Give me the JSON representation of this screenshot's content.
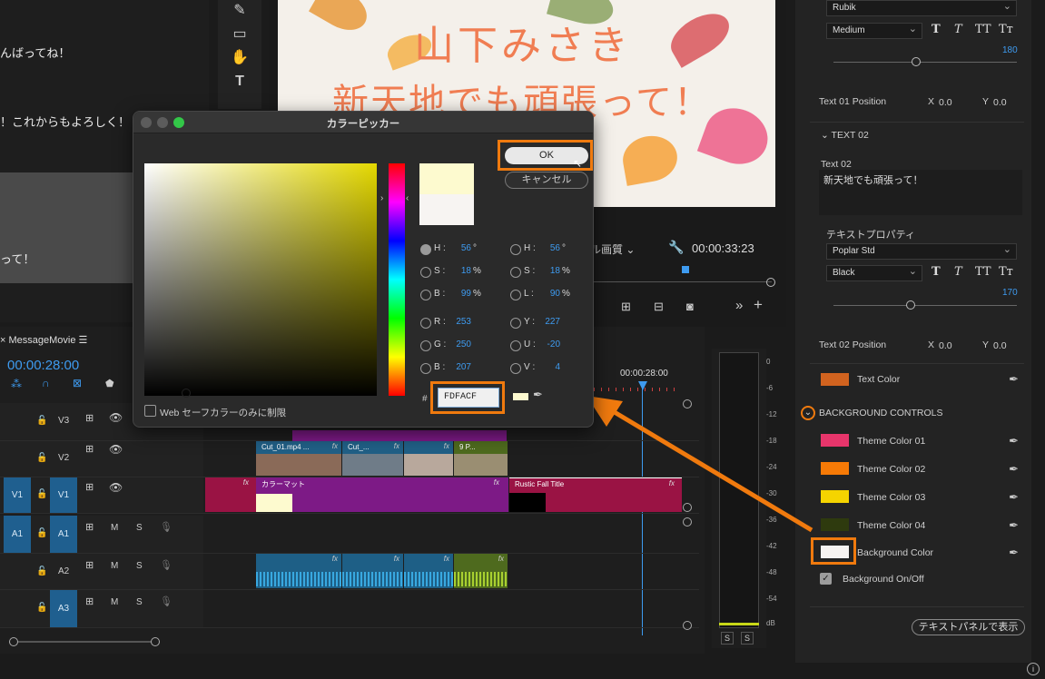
{
  "left_preview": {
    "line1": "んばってね！",
    "line2": "！これからもよろしく！",
    "line3": "って！"
  },
  "program": {
    "title_line1": "山下みさき",
    "title_line2": "新天地でも頑張って！",
    "quality": "ル画質",
    "timecode": "00:00:33:23"
  },
  "timeline": {
    "sequence_name": "MessageMovie",
    "timecode": "00:00:28:00",
    "ruler_time": "00:00:28:00",
    "tracks": [
      {
        "target": "",
        "label": "V3"
      },
      {
        "target": "",
        "label": "V2"
      },
      {
        "target": "V1",
        "label": "V1"
      },
      {
        "target": "A1",
        "label": "A1"
      },
      {
        "target": "",
        "label": "A2"
      },
      {
        "target": "",
        "label": "A3"
      }
    ],
    "track_m": "M",
    "track_s": "S",
    "v2_clips": [
      "Cut_01.mp4 ...",
      "Cut_...",
      "",
      "9 P..."
    ],
    "v1_clips": [
      "カラーマット",
      "Rustic Fall Title"
    ],
    "fx": "fx"
  },
  "meter": {
    "ticks": [
      "0",
      "-6",
      "-12",
      "-18",
      "-24",
      "-30",
      "-36",
      "-42",
      "-48",
      "-54",
      "dB"
    ],
    "solo_left": "S",
    "solo_right": "S"
  },
  "right_panel": {
    "font1": "Rubik",
    "weight1": "Medium",
    "size1": "180",
    "slider1_level": 0.45,
    "text01_pos_label": "Text 01 Position",
    "text01_x_label": "X",
    "text01_x": "0.0",
    "text01_y_label": "Y",
    "text01_y": "0.0",
    "text02_header": "TEXT 02",
    "text02_label": "Text 02",
    "text02_value": "新天地でも頑張って！",
    "text_props": "テキストプロパティ",
    "font2": "Poplar Std",
    "weight2": "Black",
    "size2": "170",
    "slider2_level": 0.42,
    "text02_pos_label": "Text 02 Position",
    "text02_x_label": "X",
    "text02_x": "0.0",
    "text02_y_label": "Y",
    "text02_y": "0.0",
    "text_color_label": "Text Color",
    "bg_controls": "BACKGROUND CONTROLS",
    "themes": [
      {
        "label": "Theme Color 01",
        "color": "#e7356b"
      },
      {
        "label": "Theme Color 02",
        "color": "#f67a06"
      },
      {
        "label": "Theme Color 03",
        "color": "#f5d400"
      },
      {
        "label": "Theme Color 04",
        "color": "#2e3a0e"
      },
      {
        "label": "Background Color",
        "color": "#f7f4f2"
      }
    ],
    "text_color": "#d1631f",
    "bg_onoff_label": "Background On/Off",
    "show_text_panel": "テキストパネルで表示"
  },
  "picker": {
    "title": "カラーピッカー",
    "ok": "OK",
    "cancel": "キャンセル",
    "left_values": [
      {
        "label": "H :",
        "value": "56",
        "unit": "°"
      },
      {
        "label": "S :",
        "value": "18",
        "unit": "%"
      },
      {
        "label": "B :",
        "value": "99",
        "unit": "%"
      },
      {
        "label": "R :",
        "value": "253",
        "unit": ""
      },
      {
        "label": "G :",
        "value": "250",
        "unit": ""
      },
      {
        "label": "B :",
        "value": "207",
        "unit": ""
      }
    ],
    "right_values": [
      {
        "label": "H :",
        "value": "56",
        "unit": "°"
      },
      {
        "label": "S :",
        "value": "18",
        "unit": "%"
      },
      {
        "label": "L :",
        "value": "90",
        "unit": "%"
      },
      {
        "label": "Y :",
        "value": "227",
        "unit": ""
      },
      {
        "label": "U :",
        "value": "-20",
        "unit": ""
      },
      {
        "label": "V :",
        "value": "4",
        "unit": ""
      }
    ],
    "hash": "#",
    "hex": "FDFACF",
    "web_safe": "Web セーフカラーのみに制限",
    "new_color": "#fdfacf",
    "old_color": "#f7f4f2"
  },
  "colors": {
    "accent_orange": "#f07a0e",
    "ui_blue": "#3e9bf0",
    "track_target": "#1f5f8f"
  }
}
